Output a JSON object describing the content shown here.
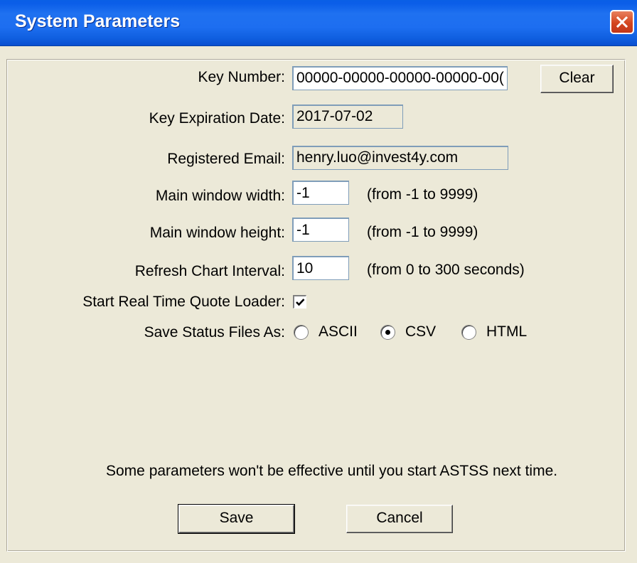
{
  "window": {
    "title": "System Parameters",
    "close_icon": "close-icon"
  },
  "form": {
    "key_number": {
      "label": "Key Number:",
      "value": "00000-00000-00000-00000-00("
    },
    "clear_button": "Clear",
    "key_expiration": {
      "label": "Key Expiration Date:",
      "value": "2017-07-02"
    },
    "registered_email": {
      "label": "Registered Email:",
      "value": "henry.luo@invest4y.com"
    },
    "main_width": {
      "label": "Main window width:",
      "value": "-1",
      "hint": "(from -1 to 9999)"
    },
    "main_height": {
      "label": "Main window height:",
      "value": "-1",
      "hint": "(from -1 to 9999)"
    },
    "refresh_interval": {
      "label": "Refresh Chart Interval:",
      "value": "10",
      "hint": "(from 0 to 300 seconds)"
    },
    "start_loader": {
      "label": "Start Real Time Quote Loader:",
      "checked": true
    },
    "save_status": {
      "label": "Save Status Files As:",
      "options": [
        "ASCII",
        "CSV",
        "HTML"
      ],
      "selected": "CSV"
    },
    "note": "Some parameters won't be effective until you start ASTSS next time."
  },
  "buttons": {
    "save": "Save",
    "cancel": "Cancel"
  },
  "colors": {
    "titlebar": "#1f71f0",
    "dialog_bg": "#ece9d8",
    "close_button": "#d4461f"
  }
}
